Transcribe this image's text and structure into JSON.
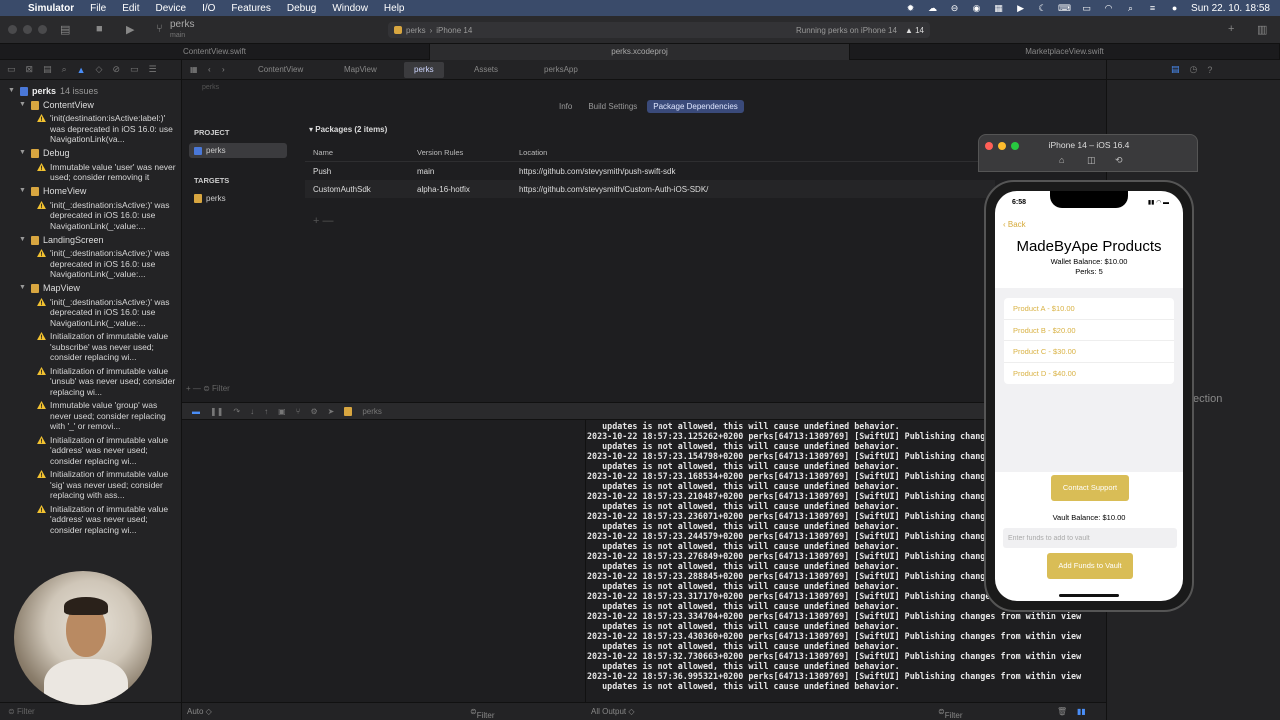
{
  "menubar": {
    "app": "Simulator",
    "items": [
      "File",
      "Edit",
      "Device",
      "I/O",
      "Features",
      "Debug",
      "Window",
      "Help"
    ],
    "clock": "Sun 22. 10.  18:58"
  },
  "toolbar": {
    "scheme": "perks",
    "branch": "main",
    "run_target_scheme": "perks",
    "run_target_device": "iPhone 14",
    "status": "Running perks on iPhone 14",
    "warnings": "14"
  },
  "tabs": {
    "left": "ContentView.swift",
    "middle": "perks.xcodeproj",
    "right": "MarketplaceView.swift"
  },
  "navigator": {
    "project": "perks",
    "issue_count": "14 issues",
    "groups": [
      {
        "file": "ContentView",
        "issues": [
          "'init(destination:isActive:label:)' was deprecated in iOS 16.0: use NavigationLink(va..."
        ]
      },
      {
        "file": "Debug",
        "issues": [
          "Immutable value 'user' was never used; consider removing it"
        ]
      },
      {
        "file": "HomeView",
        "issues": [
          "'init(_:destination:isActive:)' was deprecated in iOS 16.0: use NavigationLink(_:value:..."
        ]
      },
      {
        "file": "LandingScreen",
        "issues": [
          "'init(_:destination:isActive:)' was deprecated in iOS 16.0: use NavigationLink(_:value:..."
        ]
      },
      {
        "file": "MapView",
        "issues": [
          "'init(_:destination:isActive:)' was deprecated in iOS 16.0: use NavigationLink(_:value:...",
          "Initialization of immutable value 'subscribe' was never used; consider replacing wi...",
          "Initialization of immutable value 'unsub' was never used; consider replacing wi...",
          "Immutable value 'group' was never used; consider replacing with '_' or removi...",
          "Initialization of immutable value 'address' was never used; consider replacing wi...",
          "Initialization of immutable value 'sig' was never used; consider replacing with ass...",
          "Initialization of immutable value 'address' was never used; consider replacing wi..."
        ]
      }
    ],
    "filter_placeholder": "Filter"
  },
  "jumpbar": {
    "tabs": [
      "ContentView",
      "MapView",
      "perks",
      "Assets",
      "perksApp"
    ],
    "crumb": "perks"
  },
  "segments": [
    "Info",
    "Build Settings",
    "Package Dependencies"
  ],
  "project_sidebar": {
    "project_header": "PROJECT",
    "project_item": "perks",
    "targets_header": "TARGETS",
    "target_item": "perks",
    "filter_placeholder": "Filter"
  },
  "packages": {
    "title": "Packages (2 items)",
    "columns": [
      "Name",
      "Version Rules",
      "Location"
    ],
    "rows": [
      {
        "name": "Push",
        "rule": "main",
        "location": "https://github.com/stevysmith/push-swift-sdk"
      },
      {
        "name": "CustomAuthSdk",
        "rule": "alpha-16-hotfix",
        "location": "https://github.com/stevysmith/Custom-Auth-iOS-SDK/"
      }
    ]
  },
  "debugbar": {
    "target": "perks"
  },
  "console_lines": [
    "   updates is not allowed, this will cause undefined behavior.",
    "2023-10-22 18:57:23.125262+0200 perks[64713:1309769] [SwiftUI] Publishing changes from within view",
    "   updates is not allowed, this will cause undefined behavior.",
    "2023-10-22 18:57:23.154798+0200 perks[64713:1309769] [SwiftUI] Publishing changes from within view",
    "   updates is not allowed, this will cause undefined behavior.",
    "2023-10-22 18:57:23.168534+0200 perks[64713:1309769] [SwiftUI] Publishing changes from within view",
    "   updates is not allowed, this will cause undefined behavior.",
    "2023-10-22 18:57:23.210487+0200 perks[64713:1309769] [SwiftUI] Publishing changes from within view",
    "   updates is not allowed, this will cause undefined behavior.",
    "2023-10-22 18:57:23.236071+0200 perks[64713:1309769] [SwiftUI] Publishing changes from within view",
    "   updates is not allowed, this will cause undefined behavior.",
    "2023-10-22 18:57:23.244579+0200 perks[64713:1309769] [SwiftUI] Publishing changes from within view",
    "   updates is not allowed, this will cause undefined behavior.",
    "2023-10-22 18:57:23.276849+0200 perks[64713:1309769] [SwiftUI] Publishing changes from within view",
    "   updates is not allowed, this will cause undefined behavior.",
    "2023-10-22 18:57:23.288845+0200 perks[64713:1309769] [SwiftUI] Publishing changes from within view",
    "   updates is not allowed, this will cause undefined behavior.",
    "2023-10-22 18:57:23.317170+0200 perks[64713:1309769] [SwiftUI] Publishing changes from within view",
    "   updates is not allowed, this will cause undefined behavior.",
    "2023-10-22 18:57:23.334704+0200 perks[64713:1309769] [SwiftUI] Publishing changes from within view",
    "   updates is not allowed, this will cause undefined behavior.",
    "2023-10-22 18:57:23.430360+0200 perks[64713:1309769] [SwiftUI] Publishing changes from within view",
    "   updates is not allowed, this will cause undefined behavior.",
    "2023-10-22 18:57:32.730663+0200 perks[64713:1309769] [SwiftUI] Publishing changes from within view",
    "   updates is not allowed, this will cause undefined behavior.",
    "2023-10-22 18:57:36.995321+0200 perks[64713:1309769] [SwiftUI] Publishing changes from within view",
    "   updates is not allowed, this will cause undefined behavior."
  ],
  "bottombar": {
    "auto": "Auto ◇",
    "filter_left": "Filter",
    "all_output": "All Output ◇",
    "filter_right": "Filter"
  },
  "inspector": {
    "ghost_text": "ection"
  },
  "simulator": {
    "window_title": "iPhone 14 – iOS 16.4",
    "time": "6:58",
    "back": "Back",
    "title": "MadeByApe Products",
    "wallet_balance": "Wallet Balance: $10.00",
    "perks": "Perks: 5",
    "products": [
      "Product A - $10.00",
      "Product B - $20.00",
      "Product C - $30.00",
      "Product D - $40.00"
    ],
    "contact_support": "Contact Support",
    "vault_balance": "Vault Balance: $10.00",
    "vault_placeholder": "Enter funds to add to vault",
    "add_funds": "Add Funds to Vault"
  },
  "colors": {
    "accent_gold": "#d9bd56",
    "xcode_blue": "#4a8ef7",
    "menubar": "#3a4b6a"
  }
}
